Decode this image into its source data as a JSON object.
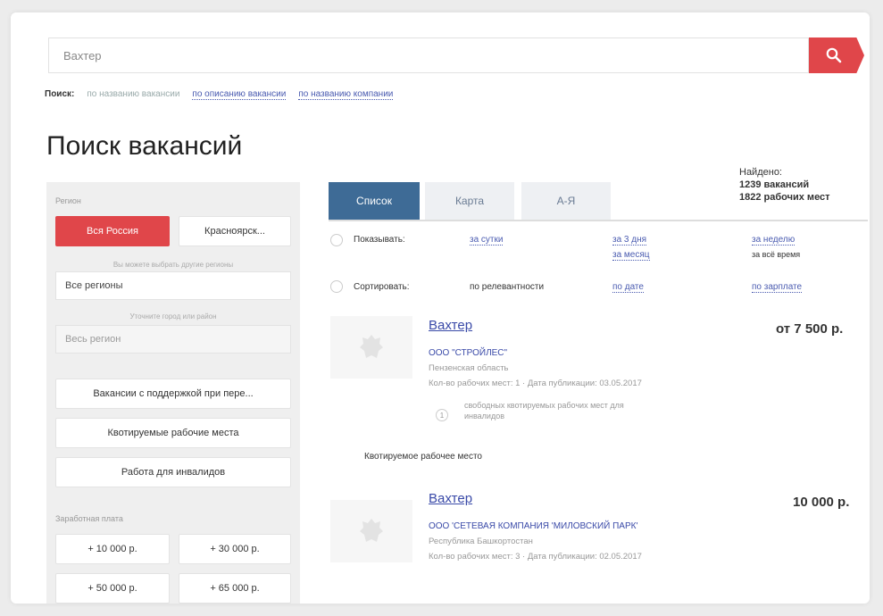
{
  "search": {
    "value": "Вахтер"
  },
  "search_modes": {
    "label": "Поиск:",
    "current": "по названию вакансии",
    "options": [
      "по описанию вакансии",
      "по названию компании"
    ]
  },
  "page_title": "Поиск вакансий",
  "found": {
    "label": "Найдено:",
    "vacancies": "1239 вакансий",
    "jobs": "1822 рабочих мест"
  },
  "sidebar": {
    "region_label": "Регион",
    "region_all": "Вся Россия",
    "region_local": "Красноярск...",
    "region_hint": "Вы можете выбрать другие регионы",
    "all_regions": "Все регионы",
    "district_hint": "Уточните город или район",
    "whole_region": "Весь регион",
    "filters": [
      "Вакансии с поддержкой при пере...",
      "Квотируемые рабочие места",
      "Работа для инвалидов"
    ],
    "salary_label": "Заработная плата",
    "salary_options": [
      "+ 10 000 р.",
      "+ 30 000 р.",
      "+ 50 000 р.",
      "+ 65 000 р."
    ]
  },
  "tabs": [
    "Список",
    "Карта",
    "А-Я"
  ],
  "show": {
    "label": "Показывать:",
    "options": [
      "за сутки",
      "за 3 дня",
      "за месяц",
      "за неделю",
      "за всё время"
    ]
  },
  "sort": {
    "label": "Сортировать:",
    "current": "по релевантности",
    "options": [
      "по дате",
      "по зарплате"
    ]
  },
  "vacancies": [
    {
      "title": "Вахтер",
      "salary": "от 7 500 р.",
      "company": "ООО \"СТРОЙЛЕС\"",
      "region": "Пензенская область",
      "meta": "Кол-во рабочих мест: 1 · Дата публикации: 03.05.2017",
      "note": "свободных квотируемых рабочих мест для инвалидов",
      "note_count": "1",
      "tag": "Квотируемое рабочее место"
    },
    {
      "title": "Вахтер",
      "salary": "10 000 р.",
      "company": "ООО 'СЕТЕВАЯ КОМПАНИЯ 'МИЛОВСКИЙ ПАРК'",
      "region": "Республика Башкортостан",
      "meta": "Кол-во рабочих мест: 3 · Дата публикации: 02.05.2017"
    }
  ],
  "colors": {
    "accent_red": "#e0464a",
    "tab_active": "#3e6b96",
    "link": "#4a5bb0"
  }
}
